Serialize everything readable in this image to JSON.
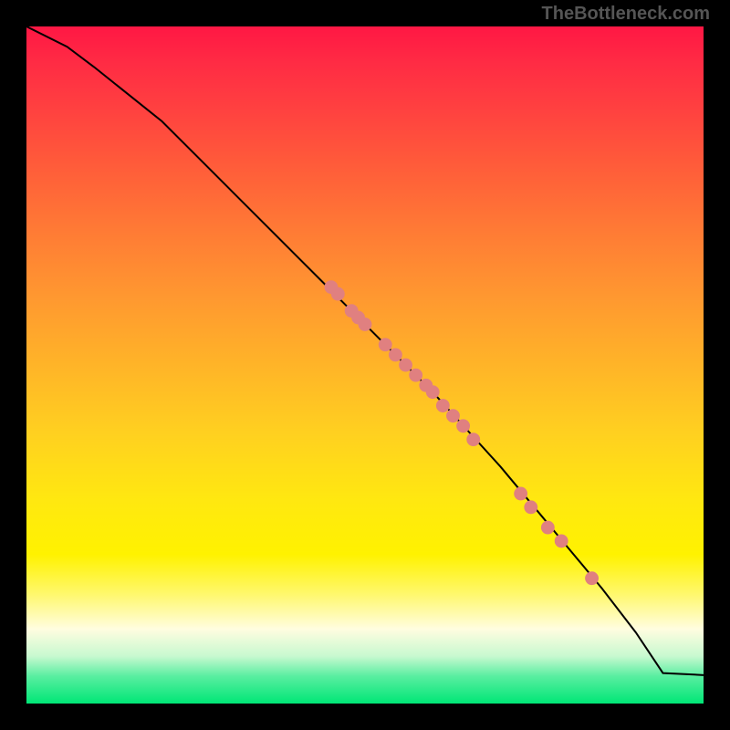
{
  "watermark": "TheBottleneck.com",
  "chart_data": {
    "type": "line",
    "title": "",
    "xlabel": "",
    "ylabel": "",
    "xlim": [
      0,
      100
    ],
    "ylim": [
      0,
      100
    ],
    "line": {
      "x": [
        0,
        6,
        10,
        15,
        20,
        25,
        30,
        35,
        40,
        45,
        50,
        55,
        60,
        65,
        70,
        75,
        80,
        85,
        90,
        94,
        100
      ],
      "y": [
        100,
        97,
        94,
        90,
        86,
        81,
        76,
        71,
        66,
        61,
        56,
        51,
        46,
        40.5,
        35,
        29,
        23,
        17,
        10.5,
        4.5,
        4.2
      ]
    },
    "points": [
      {
        "x": 45.0,
        "y": 61.5
      },
      {
        "x": 46.0,
        "y": 60.5
      },
      {
        "x": 48.0,
        "y": 58.0
      },
      {
        "x": 49.0,
        "y": 57.0
      },
      {
        "x": 50.0,
        "y": 56.0
      },
      {
        "x": 53.0,
        "y": 53.0
      },
      {
        "x": 54.5,
        "y": 51.5
      },
      {
        "x": 56.0,
        "y": 50.0
      },
      {
        "x": 57.5,
        "y": 48.5
      },
      {
        "x": 59.0,
        "y": 47.0
      },
      {
        "x": 60.0,
        "y": 46.0
      },
      {
        "x": 61.5,
        "y": 44.0
      },
      {
        "x": 63.0,
        "y": 42.5
      },
      {
        "x": 64.5,
        "y": 41.0
      },
      {
        "x": 66.0,
        "y": 39.0
      },
      {
        "x": 73.0,
        "y": 31.0
      },
      {
        "x": 74.5,
        "y": 29.0
      },
      {
        "x": 77.0,
        "y": 26.0
      },
      {
        "x": 79.0,
        "y": 24.0
      },
      {
        "x": 83.5,
        "y": 18.5
      }
    ],
    "point_color": "#e08080",
    "gradient_stops": [
      {
        "pos": 0,
        "color": "#ff1744"
      },
      {
        "pos": 50,
        "color": "#ffd020"
      },
      {
        "pos": 80,
        "color": "#fff200"
      },
      {
        "pos": 100,
        "color": "#00e676"
      }
    ]
  }
}
